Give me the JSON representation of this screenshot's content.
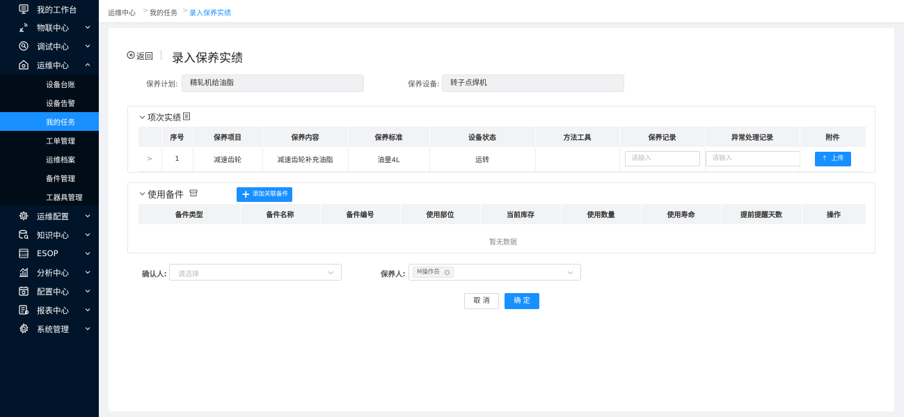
{
  "sidebar": {
    "items": [
      {
        "label": "我的工作台",
        "icon": "workbench-icon",
        "chevron": "none"
      },
      {
        "label": "物联中心",
        "icon": "iot-icon",
        "chevron": "down"
      },
      {
        "label": "调试中心",
        "icon": "debug-icon",
        "chevron": "down"
      },
      {
        "label": "运维中心",
        "icon": "maintenance-icon",
        "chevron": "up"
      },
      {
        "label": "运维配置",
        "icon": "gear-icon",
        "chevron": "down"
      },
      {
        "label": "知识中心",
        "icon": "knowledge-icon",
        "chevron": "down"
      },
      {
        "label": "ESOP",
        "icon": "esop-icon",
        "chevron": "down"
      },
      {
        "label": "分析中心",
        "icon": "chart-icon",
        "chevron": "down"
      },
      {
        "label": "配置中心",
        "icon": "config-icon",
        "chevron": "down"
      },
      {
        "label": "报表中心",
        "icon": "report-icon",
        "chevron": "down"
      },
      {
        "label": "系统管理",
        "icon": "settings-icon",
        "chevron": "down"
      }
    ],
    "sub_items": [
      {
        "label": "设备台账",
        "active": false
      },
      {
        "label": "设备告警",
        "active": false
      },
      {
        "label": "我的任务",
        "active": true
      },
      {
        "label": "工单管理",
        "active": false
      },
      {
        "label": "运维档案",
        "active": false
      },
      {
        "label": "备件管理",
        "active": false
      },
      {
        "label": "工器具管理",
        "active": false
      }
    ]
  },
  "breadcrumb": {
    "items": [
      "运维中心",
      "我的任务",
      "录入保养实绩"
    ],
    "separator": ">"
  },
  "header": {
    "back_label": "返回",
    "title": "录入保养实绩"
  },
  "form": {
    "plan_label": "保养计划:",
    "plan_value": "精轧机给油脂",
    "device_label": "保养设备:",
    "device_value": "转子点焊机"
  },
  "items_section": {
    "title": "项次实绩",
    "columns": [
      "序号",
      "保养项目",
      "保养内容",
      "保养标准",
      "设备状态",
      "方法工具",
      "保养记录",
      "异常处理记录",
      "附件"
    ],
    "rows": [
      {
        "expand": ">",
        "seq": "1",
        "item": "减速齿轮",
        "content": "减速齿轮补充油脂",
        "standard": "油量4L",
        "status": "运转",
        "method": "",
        "record_placeholder": "请输入",
        "exception_placeholder": "请输入",
        "upload_label": "上传"
      }
    ]
  },
  "parts_section": {
    "title": "使用备件",
    "add_button": "添加关联备件",
    "columns": [
      "备件类型",
      "备件名称",
      "备件编号",
      "使用部位",
      "当前库存",
      "使用数量",
      "使用寿命",
      "提前提醒天数",
      "操作"
    ],
    "empty_text": "暂无数据"
  },
  "footer": {
    "confirmer_label": "确认人:",
    "confirmer_placeholder": "请选择",
    "maintainer_label": "保养人:",
    "maintainer_tag": "M操作员",
    "cancel": "取 消",
    "ok": "确 定"
  },
  "colors": {
    "sidebar_bg": "#001529",
    "submenu_bg": "#000c17",
    "primary": "#1890ff",
    "page_bg": "#f0f2f5"
  }
}
